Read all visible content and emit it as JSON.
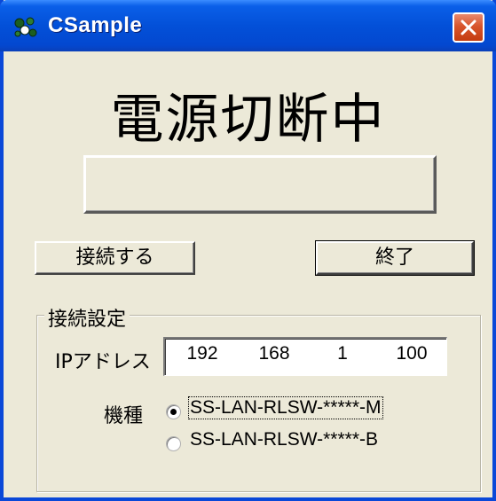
{
  "window": {
    "title": "CSample",
    "title_bar_color": "#0350d8",
    "close_button_color": "#d8552c",
    "background_color": "#ece9d8"
  },
  "icons": {
    "app": "app-icon",
    "close": "close-icon"
  },
  "status": {
    "text": "電源切断中",
    "indicator_value": ""
  },
  "buttons": {
    "connect_label": "接続する",
    "exit_label": "終了"
  },
  "connection_settings": {
    "group_title": "接続設定",
    "ip_label": "IPアドレス",
    "ip_octets": [
      "192",
      "168",
      "1",
      "100"
    ],
    "model_label": "機種",
    "models": [
      {
        "label": "SS-LAN-RLSW-*****-M",
        "selected": true
      },
      {
        "label": "SS-LAN-RLSW-*****-B",
        "selected": false
      }
    ]
  }
}
